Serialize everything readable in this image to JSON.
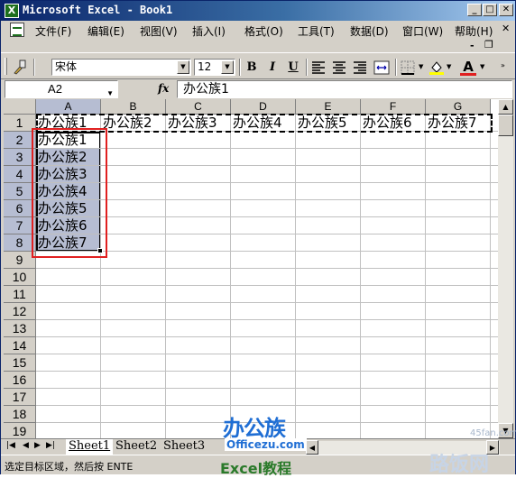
{
  "window": {
    "icon": "X",
    "title": "Microsoft Excel - Book1",
    "min_label": "_",
    "max_label": "□",
    "close_label": "✕"
  },
  "menu": {
    "items": [
      "文件(F)",
      "编辑(E)",
      "视图(V)",
      "插入(I)",
      "格式(O)",
      "工具(T)",
      "数据(D)",
      "窗口(W)",
      "帮助(H)"
    ],
    "close_label": "✕",
    "sub_min_label": "-",
    "sub_restore_label": "❐"
  },
  "toolbar": {
    "font_name": "宋体",
    "font_size": "12",
    "bold": "B",
    "italic": "I",
    "underline": "U",
    "font_color_label": "A",
    "accent_color": "#e02020"
  },
  "formula": {
    "name_box": "A2",
    "fx_label": "fx",
    "value": "办公族1"
  },
  "grid": {
    "columns": [
      "A",
      "B",
      "C",
      "D",
      "E",
      "F",
      "G"
    ],
    "rows": [
      "1",
      "2",
      "3",
      "4",
      "5",
      "6",
      "7",
      "8",
      "9",
      "10",
      "11",
      "12",
      "13",
      "14",
      "15",
      "16",
      "17",
      "18",
      "19"
    ],
    "row1": [
      "办公族1",
      "办公族2",
      "办公族3",
      "办公族4",
      "办公族5",
      "办公族6",
      "办公族7"
    ],
    "colA": [
      "办公族1",
      "办公族2",
      "办公族3",
      "办公族4",
      "办公族5",
      "办公族6",
      "办公族7"
    ]
  },
  "sheets": {
    "tabs": [
      "Sheet1",
      "Sheet2",
      "Sheet3"
    ],
    "active": "Sheet1"
  },
  "status": {
    "text": "选定目标区域，然后按 ENTE"
  },
  "watermark": {
    "logo": "办公族",
    "url": "Officezu.com",
    "tutorial": "Excel教程",
    "site": "路饭网",
    "site_url": "45fan.com"
  }
}
